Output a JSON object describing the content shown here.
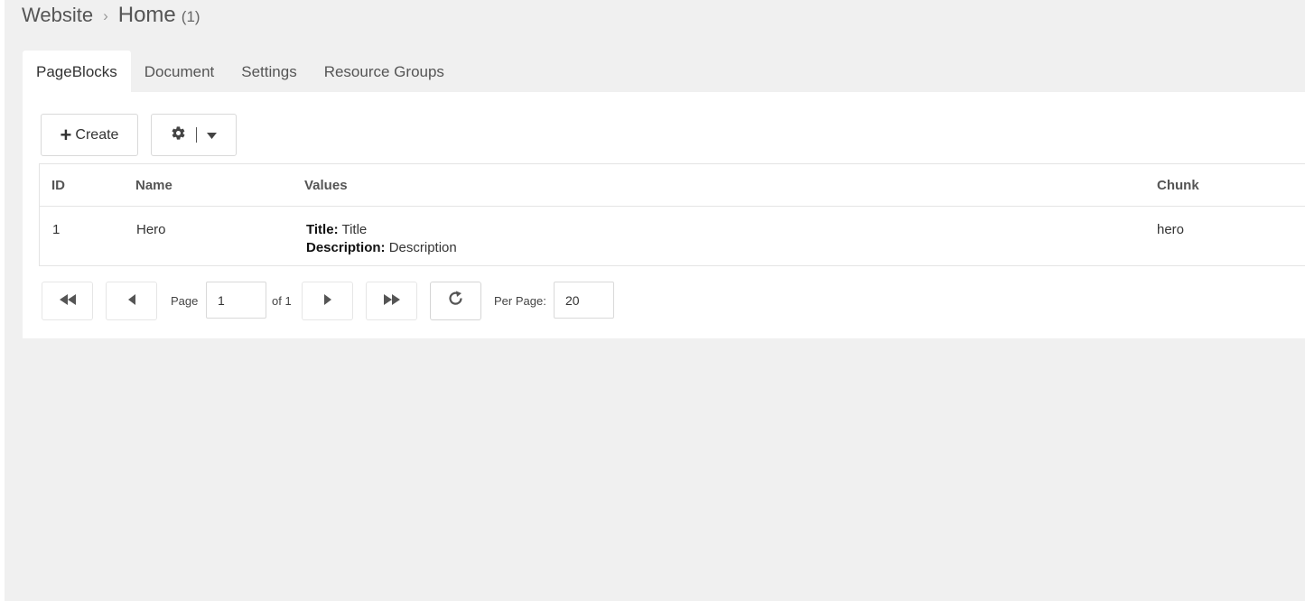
{
  "breadcrumb": {
    "parent": "Website",
    "separator": "›",
    "current": "Home",
    "count": "(1)"
  },
  "tabs": [
    {
      "label": "PageBlocks",
      "active": true
    },
    {
      "label": "Document",
      "active": false
    },
    {
      "label": "Settings",
      "active": false
    },
    {
      "label": "Resource Groups",
      "active": false
    }
  ],
  "toolbar": {
    "create_label": "Create",
    "create_icon": "plus-icon",
    "settings_icon": "gear-icon",
    "settings_dropdown_icon": "caret-down-icon"
  },
  "grid": {
    "columns": [
      "ID",
      "Name",
      "Values",
      "Chunk"
    ],
    "rows": [
      {
        "id": "1",
        "name": "Hero",
        "values": [
          {
            "key": "Title:",
            "value": "Title"
          },
          {
            "key": "Description:",
            "value": "Description"
          }
        ],
        "chunk": "hero"
      }
    ]
  },
  "pager": {
    "page_label": "Page",
    "page_value": "1",
    "of_label": "of 1",
    "per_page_label": "Per Page:",
    "per_page_value": "20"
  },
  "colors": {
    "background": "#f0f0f0",
    "panel": "#ffffff",
    "border": "#e4e4e4",
    "text": "#333333"
  }
}
